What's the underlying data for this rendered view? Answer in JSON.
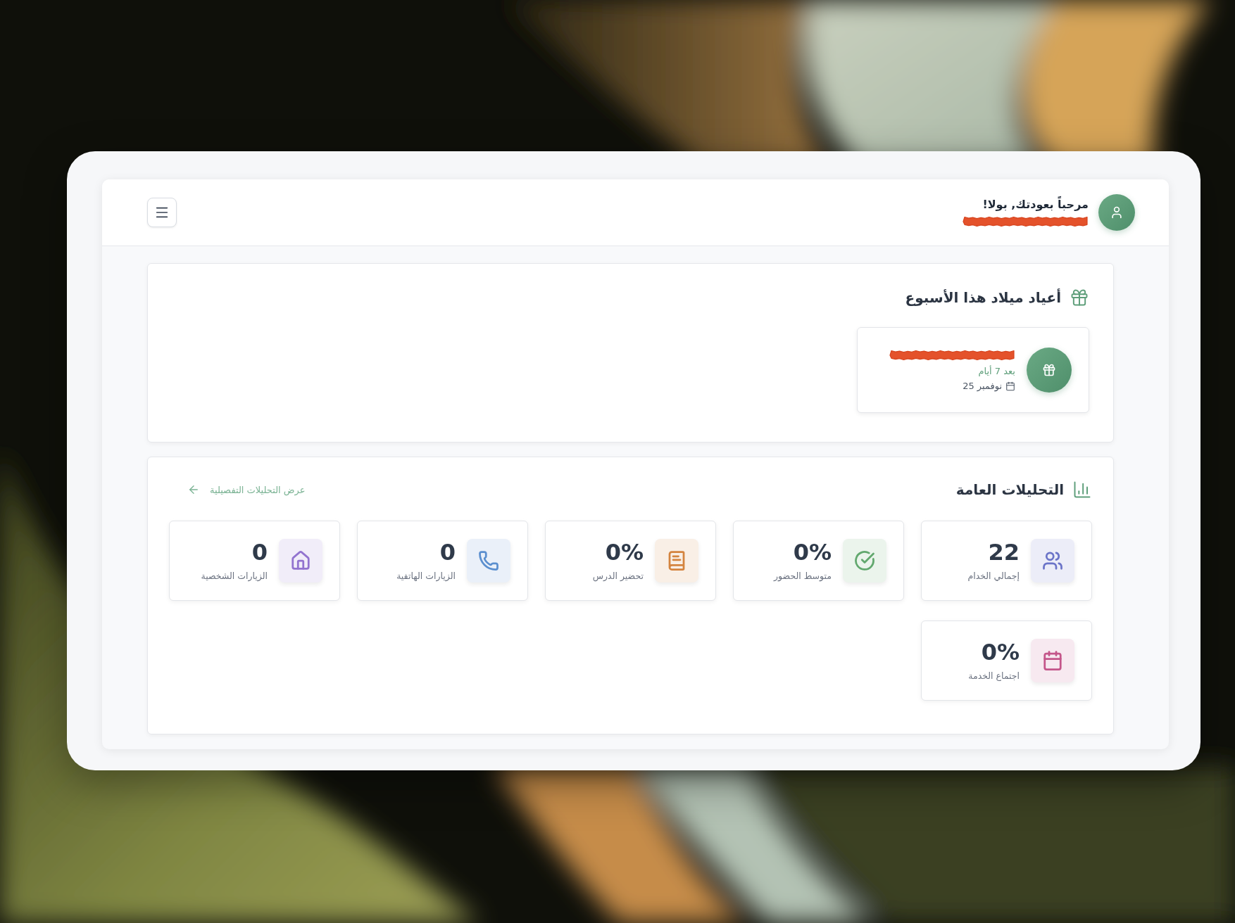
{
  "header": {
    "greeting": "مرحباً بعودتك, بولا!",
    "name_redacted": true
  },
  "birthdays": {
    "title": "أعياد ميلاد هذا الأسبوع",
    "items": [
      {
        "name_redacted": true,
        "countdown": "بعد 7 أيام",
        "date": "نوفمبر 25"
      }
    ]
  },
  "analytics": {
    "title": "التحليلات العامة",
    "link": "عرض التحليلات التفصيلية",
    "stats": [
      {
        "kind": "people",
        "value": "22",
        "label": "إجمالي الخدام",
        "color": "#6b74c8"
      },
      {
        "kind": "check",
        "value": "0%",
        "label": "متوسط الحضور",
        "color": "#62a86e"
      },
      {
        "kind": "book",
        "value": "0%",
        "label": "تحضير الدرس",
        "color": "#d4843f"
      },
      {
        "kind": "phone",
        "value": "0",
        "label": "الزيارات الهاتفية",
        "color": "#5b8fcf"
      },
      {
        "kind": "home",
        "value": "0",
        "label": "الزيارات الشخصية",
        "color": "#9273cf"
      },
      {
        "kind": "calendar",
        "value": "0%",
        "label": "اجتماع الخدمة",
        "color": "#c4568a"
      }
    ]
  }
}
